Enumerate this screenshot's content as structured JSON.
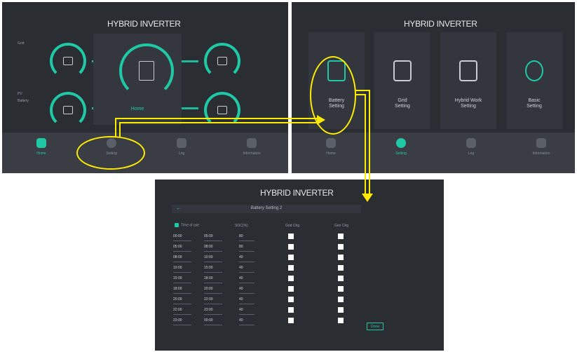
{
  "colors": {
    "accent": "#1fc9a6",
    "panel_bg": "#2a2d32",
    "annotation": "#ffeb00"
  },
  "panels": {
    "home": {
      "title": "HYBRID INVERTER",
      "left_labels": [
        "Grid",
        "PV",
        "Battery"
      ],
      "center_label": "Home",
      "nav": [
        "Home",
        "Setting",
        "Log",
        "Information"
      ]
    },
    "settings": {
      "title": "HYBRID INVERTER",
      "cards": [
        {
          "label": "Battery\nSetting",
          "icon": "battery-gear-icon"
        },
        {
          "label": "Grid\nSetting",
          "icon": "tower-icon"
        },
        {
          "label": "Hybrid Work\nSetting",
          "icon": "engineer-icon"
        },
        {
          "label": "Basic\nSetting",
          "icon": "gear-bolt-icon"
        }
      ],
      "nav": [
        "Home",
        "Setting",
        "Log",
        "Information"
      ]
    },
    "battery": {
      "title": "HYBRID INVERTER",
      "subtitle": "Battery Setting 2",
      "headers": [
        "Time of use",
        "SOC(%)",
        "Grid Chg",
        "Gen Chg"
      ],
      "rows": [
        [
          "00:00",
          "05:00",
          "80"
        ],
        [
          "05:00",
          "08:00",
          "80"
        ],
        [
          "08:00",
          "10:00",
          "40"
        ],
        [
          "10:00",
          "15:00",
          "40"
        ],
        [
          "15:00",
          "18:00",
          "40"
        ],
        [
          "18:00",
          "20:00",
          "40"
        ],
        [
          "20:00",
          "22:00",
          "40"
        ],
        [
          "22:00",
          "23:00",
          "40"
        ],
        [
          "23:00",
          "00:00",
          "40"
        ]
      ],
      "done_label": "Done"
    }
  }
}
